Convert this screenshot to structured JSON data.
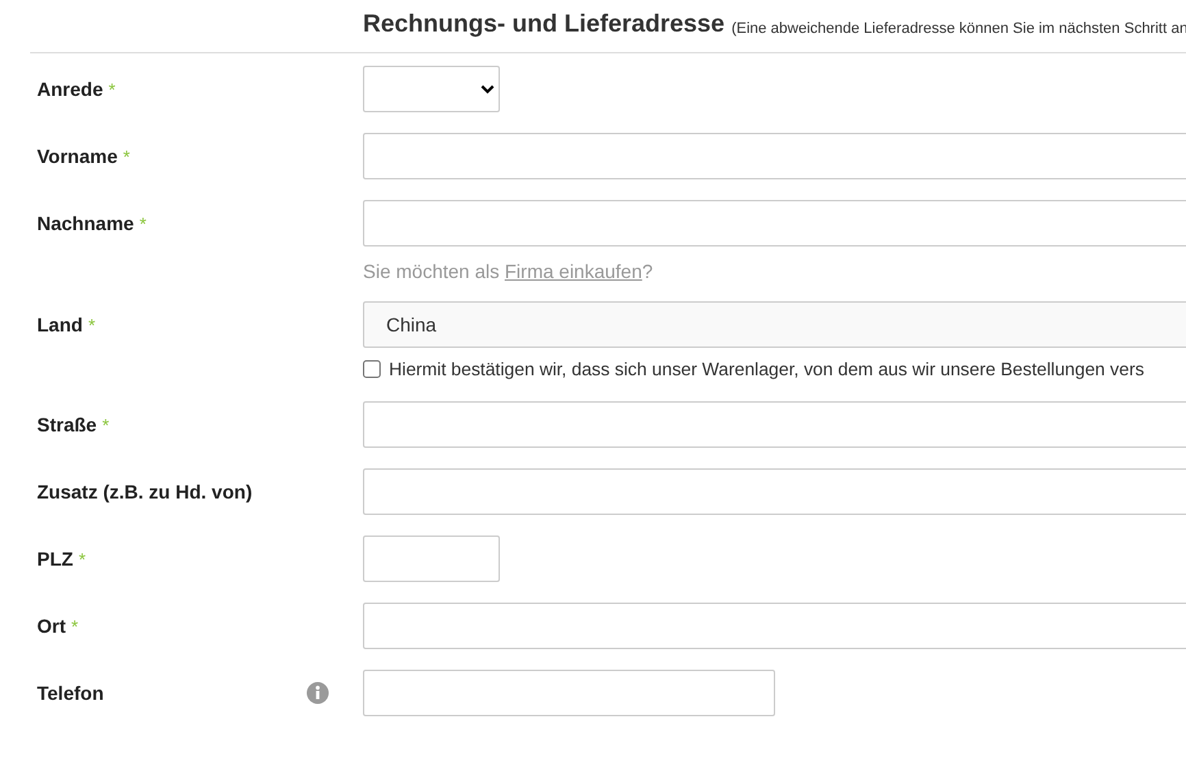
{
  "heading": {
    "title": "Rechnungs- und Lieferadresse",
    "note": "(Eine abweichende Lieferadresse können Sie im nächsten Schritt an"
  },
  "rows": [
    {
      "kind": "select",
      "label": "Anrede",
      "required_mark": "*"
    },
    {
      "kind": "text",
      "label": "Vorname",
      "required_mark": "*"
    },
    {
      "kind": "text",
      "label": "Nachname",
      "required_mark": "*"
    },
    {
      "kind": "hint",
      "before": "Sie möchten als ",
      "link": "Firma einkaufen",
      "after": "?"
    },
    {
      "kind": "readonly",
      "label": "Land",
      "required_mark": "*",
      "value": "China"
    },
    {
      "kind": "checkbox",
      "text": "Hiermit bestätigen wir, dass sich unser Warenlager, von dem aus wir unsere Bestellungen vers",
      "checked": false
    },
    {
      "kind": "text",
      "label": "Straße",
      "required_mark": "*"
    },
    {
      "kind": "text",
      "label": "Zusatz (z.B. zu Hd. von)"
    },
    {
      "kind": "short",
      "label": "PLZ",
      "required_mark": "*"
    },
    {
      "kind": "text",
      "label": "Ort",
      "required_mark": "*"
    },
    {
      "kind": "medium",
      "label": "Telefon",
      "info": true
    }
  ]
}
